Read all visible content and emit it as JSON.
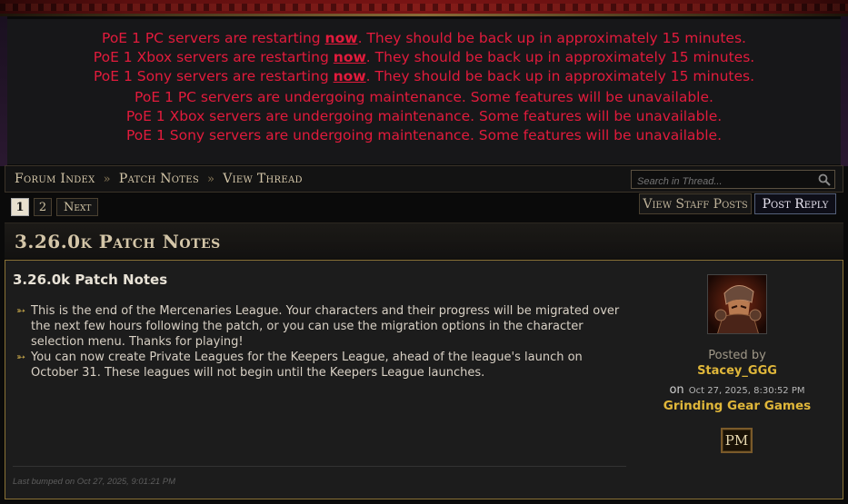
{
  "announcements": {
    "restart": [
      {
        "before": "PoE 1 PC servers are restarting ",
        "now": "now",
        "after": ". They should be back up in approximately 15 minutes."
      },
      {
        "before": "PoE 1 Xbox servers are restarting ",
        "now": "now",
        "after": ". They should be back up in approximately 15 minutes."
      },
      {
        "before": "PoE 1 Sony servers are restarting ",
        "now": "now",
        "after": ". They should be back up in approximately 15 minutes."
      }
    ],
    "maintenance": [
      "PoE 1 PC servers are undergoing maintenance. Some features will be unavailable.",
      "PoE 1 Xbox servers are undergoing maintenance. Some features will be unavailable.",
      "PoE 1 Sony servers are undergoing maintenance. Some features will be unavailable."
    ],
    "color": "#e21b3c"
  },
  "breadcrumb": {
    "items": [
      "Forum Index",
      "Patch Notes",
      "View Thread"
    ],
    "separator": "»"
  },
  "search": {
    "placeholder": "Search in Thread..."
  },
  "pagination": {
    "pages": [
      "1",
      "2"
    ],
    "current": "1",
    "next_label": "Next"
  },
  "actions": {
    "view_staff_posts": "View Staff Posts",
    "post_reply": "Post Reply"
  },
  "thread": {
    "title": "3.26.0k Patch Notes"
  },
  "post": {
    "title": "3.26.0k Patch Notes",
    "bullets": [
      "This is the end of the Mercenaries League. Your characters and their progress will be migrated over the next few hours following the patch, or you can use the migration options in the character selection menu. Thanks for playing!",
      "You can now create Private Leagues for the Keepers League, ahead of the league's launch on October 31. These leagues will not begin until the Keepers League launches."
    ],
    "last_bumped": "Last bumped on Oct 27, 2025, 9:01:21 PM",
    "author": {
      "posted_by_label": "Posted by",
      "name": "Stacey_GGG",
      "on_label": "on",
      "date": "Oct 27, 2025, 8:30:52 PM",
      "company": "Grinding Gear Games",
      "pm_label": "PM"
    }
  },
  "colors": {
    "accent_gold": "#e0b73a",
    "border_gold": "#8a7236",
    "alert_red": "#e21b3c"
  },
  "icons": {
    "search": "search-icon",
    "bullet": "bullet-arrow-icon",
    "avatar": "avatar"
  }
}
